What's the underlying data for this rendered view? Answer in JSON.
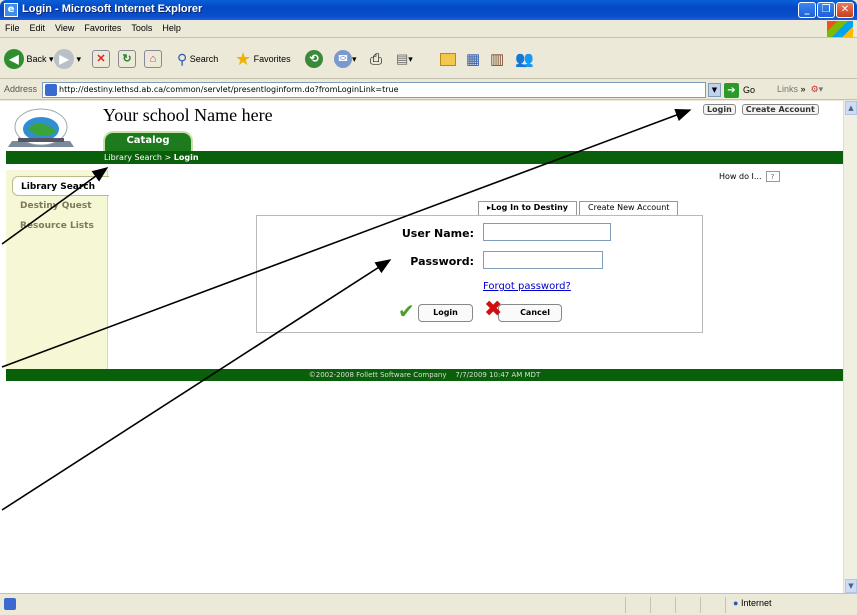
{
  "window": {
    "title": "Login - Microsoft Internet Explorer"
  },
  "menu": [
    "File",
    "Edit",
    "View",
    "Favorites",
    "Tools",
    "Help"
  ],
  "toolbar": {
    "back": "Back",
    "search": "Search",
    "favorites": "Favorites"
  },
  "address": {
    "label": "Address",
    "url": "http://destiny.lethsd.ab.ca/common/servlet/presentloginform.do?fromLoginLink=true",
    "go": "Go",
    "links": "Links"
  },
  "header": {
    "school_name": "Your school Name here",
    "login_link": "Login",
    "create_account_link": "Create Account",
    "catalog_tab": "Catalog",
    "breadcrumb_parent": "Library Search",
    "breadcrumb_sep": " > ",
    "breadcrumb_current": "Login"
  },
  "sidebar": {
    "items": [
      {
        "label": "Library Search"
      },
      {
        "label": "Destiny Quest"
      },
      {
        "label": "Resource Lists"
      }
    ]
  },
  "help": {
    "label": "How do I...",
    "icon": "?"
  },
  "login": {
    "tab_login": "Log In to Destiny",
    "tab_create": "Create New Account",
    "username_label": "User Name:",
    "password_label": "Password:",
    "username_value": "",
    "password_value": "",
    "forgot": "Forgot password?",
    "login_button": "Login",
    "cancel_button": "Cancel"
  },
  "footer": {
    "copyright": "©2002-2008  Follett Software Company",
    "datetime": "7/7/2009 10:47 AM MDT"
  },
  "status": {
    "zone": "Internet"
  },
  "colors": {
    "green": "#0a5f0a",
    "titlebar": "#0348c6",
    "sidebar": "#f6f7d5"
  }
}
